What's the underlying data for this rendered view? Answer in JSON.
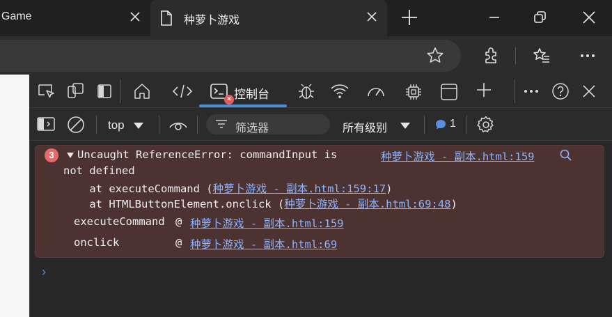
{
  "browser": {
    "tabs": [
      {
        "title": "Game"
      },
      {
        "title": "种萝卜游戏"
      }
    ]
  },
  "devtools": {
    "tabs": {
      "console_label": "控制台",
      "console_error_badge": "×"
    },
    "filterbar": {
      "context": "top",
      "filter_placeholder": "筛选器",
      "levels": "所有级别",
      "message_count": "1"
    },
    "console": {
      "error": {
        "count": "3",
        "line1": "Uncaught ReferenceError: commandInput is",
        "line2": "not defined",
        "source": "种萝卜游戏 - 副本.html:159",
        "stack": [
          {
            "prefix": "    at executeCommand (",
            "link": "种萝卜游戏 - 副本.html:159:17",
            "suffix": ")"
          },
          {
            "prefix": "    at HTMLButtonElement.onclick (",
            "link": "种萝卜游戏 - 副本.html:69:48",
            "suffix": ")"
          }
        ],
        "frames": [
          {
            "fn": "executeCommand",
            "at": "@",
            "link": "种萝卜游戏 - 副本.html:159"
          },
          {
            "fn": "onclick",
            "at": "@",
            "link": "种萝卜游戏 - 副本.html:69"
          }
        ]
      },
      "prompt": "›"
    }
  },
  "colors": {
    "accent": "#4c8fd6",
    "error_bg": "#4d3232",
    "link": "#8cb4ff"
  }
}
